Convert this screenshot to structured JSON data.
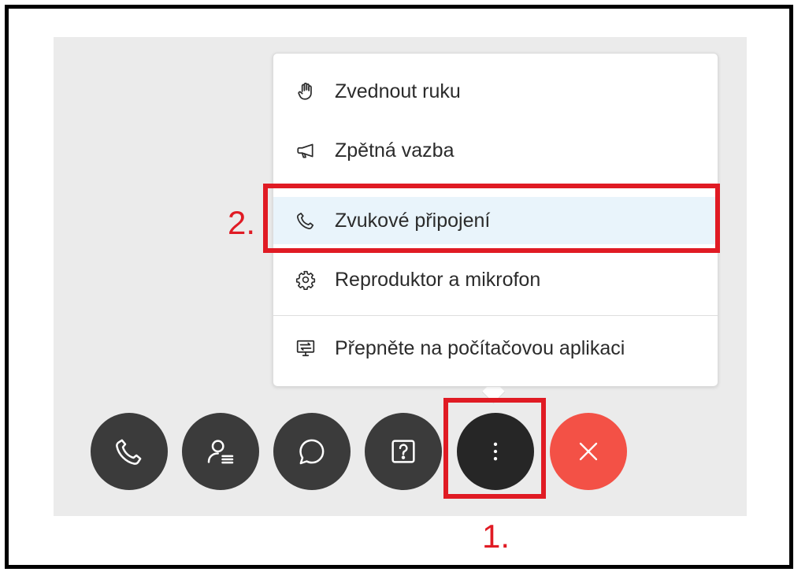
{
  "menu": {
    "items": [
      {
        "label": "Zvednout ruku",
        "icon": "raise-hand-icon"
      },
      {
        "label": "Zpětná vazba",
        "icon": "megaphone-icon"
      },
      {
        "label": "Zvukové připojení",
        "icon": "phone-icon"
      },
      {
        "label": "Reproduktor a mikrofon",
        "icon": "gear-icon"
      },
      {
        "label": "Přepněte na počítačovou aplikaci",
        "icon": "switch-desktop-icon"
      }
    ]
  },
  "toolbar": {
    "buttons": [
      {
        "name": "audio",
        "icon": "phone-icon"
      },
      {
        "name": "participants",
        "icon": "participants-icon"
      },
      {
        "name": "chat",
        "icon": "chat-icon"
      },
      {
        "name": "help",
        "icon": "question-box-icon"
      },
      {
        "name": "more",
        "icon": "more-vertical-icon"
      },
      {
        "name": "leave",
        "icon": "close-icon"
      }
    ]
  },
  "annotations": {
    "step1": "1.",
    "step2": "2."
  },
  "colors": {
    "annotation": "#e01b24",
    "end_call": "#f35146",
    "button": "#3b3b3b",
    "highlight_row": "#e9f4fb"
  }
}
